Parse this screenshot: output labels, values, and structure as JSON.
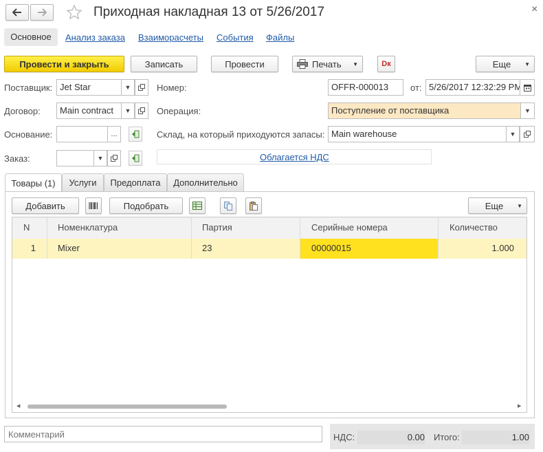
{
  "window": {
    "title": "Приходная накладная 13 от 5/26/2017",
    "close_glyph": "×"
  },
  "nav": {
    "tabs": [
      "Основное",
      "Анализ заказа",
      "Взаиморасчеты",
      "События",
      "Файлы"
    ]
  },
  "toolbar": {
    "post_close": "Провести и закрыть",
    "save": "Записать",
    "post": "Провести",
    "print": "Печать",
    "dk": "Dк",
    "more": "Еще"
  },
  "form": {
    "supplier_label": "Поставщик:",
    "supplier_value": "Jet Star",
    "contract_label": "Договор:",
    "contract_value": "Main contract",
    "basis_label": "Основание:",
    "basis_value": "",
    "basis_ellipsis": "...",
    "order_label": "Заказ:",
    "order_value": "",
    "number_label": "Номер:",
    "number_value": "OFFR-000013",
    "date_label": "от:",
    "date_value": "5/26/2017 12:32:29 PM",
    "operation_label": "Операция:",
    "operation_value": "Поступление от поставщика",
    "warehouse_label": "Склад, на который приходуются запасы:",
    "warehouse_value": "Main warehouse",
    "vat_link": "Облагается НДС"
  },
  "doc_tabs": [
    "Товары (1)",
    "Услуги",
    "Предоплата",
    "Дополнительно"
  ],
  "table_toolbar": {
    "add": "Добавить",
    "pick": "Подобрать",
    "more": "Еще"
  },
  "table": {
    "columns": [
      "N",
      "Номенклатура",
      "Партия",
      "Серийные номера",
      "Количество"
    ],
    "rows": [
      {
        "n": "1",
        "item": "Mixer",
        "batch": "23",
        "serial": "00000015",
        "qty": "1.000"
      }
    ]
  },
  "footer": {
    "comment_placeholder": "Комментарий",
    "vat_label": "НДС:",
    "vat_value": "0.00",
    "total_label": "Итого:",
    "total_value": "1.00"
  },
  "colors": {
    "accent_yellow": "#f7d600",
    "selected_row": "#fdf4c0",
    "selected_cell": "#ffe11f",
    "link": "#1f5aa8",
    "operation_bg": "#fce8c3"
  }
}
